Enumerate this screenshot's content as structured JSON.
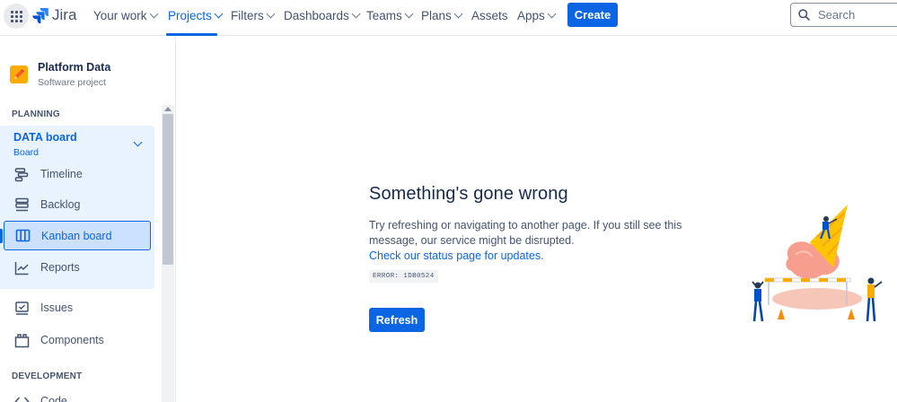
{
  "topnav": {
    "logo": "Jira",
    "items": [
      {
        "label": "Your work",
        "active": false
      },
      {
        "label": "Projects",
        "active": true
      },
      {
        "label": "Filters",
        "active": false
      },
      {
        "label": "Dashboards",
        "active": false
      },
      {
        "label": "Teams",
        "active": false
      },
      {
        "label": "Plans",
        "active": false
      },
      {
        "label": "Assets",
        "active": false
      },
      {
        "label": "Apps",
        "active": false
      }
    ],
    "create_label": "Create",
    "search_placeholder": "Search"
  },
  "sidebar": {
    "project": {
      "name": "Platform Data",
      "type": "Software project"
    },
    "planning_heading": "PLANNING",
    "board": {
      "title": "DATA board",
      "subtitle": "Board"
    },
    "board_items": [
      {
        "label": "Timeline",
        "icon": "timeline-icon"
      },
      {
        "label": "Backlog",
        "icon": "backlog-icon"
      },
      {
        "label": "Kanban board",
        "icon": "kanban-board-icon",
        "selected": true
      },
      {
        "label": "Reports",
        "icon": "reports-icon"
      }
    ],
    "items": [
      {
        "label": "Issues",
        "icon": "issues-icon"
      },
      {
        "label": "Components",
        "icon": "components-icon"
      }
    ],
    "development_heading": "DEVELOPMENT",
    "dev_items": [
      {
        "label": "Code",
        "icon": "code-icon"
      }
    ]
  },
  "error": {
    "title": "Something's gone wrong",
    "body": "Try refreshing or navigating to another page. If you still see this message, our service might be disrupted.",
    "link": "Check our status page for updates.",
    "code": "ERROR: 1DB0524",
    "refresh_label": "Refresh"
  },
  "colors": {
    "brand": "#0c66e4",
    "text": "#172b4d",
    "subtle": "#44546f",
    "selected_bg": "#cce0ff",
    "group_bg": "#e9f2ff"
  }
}
